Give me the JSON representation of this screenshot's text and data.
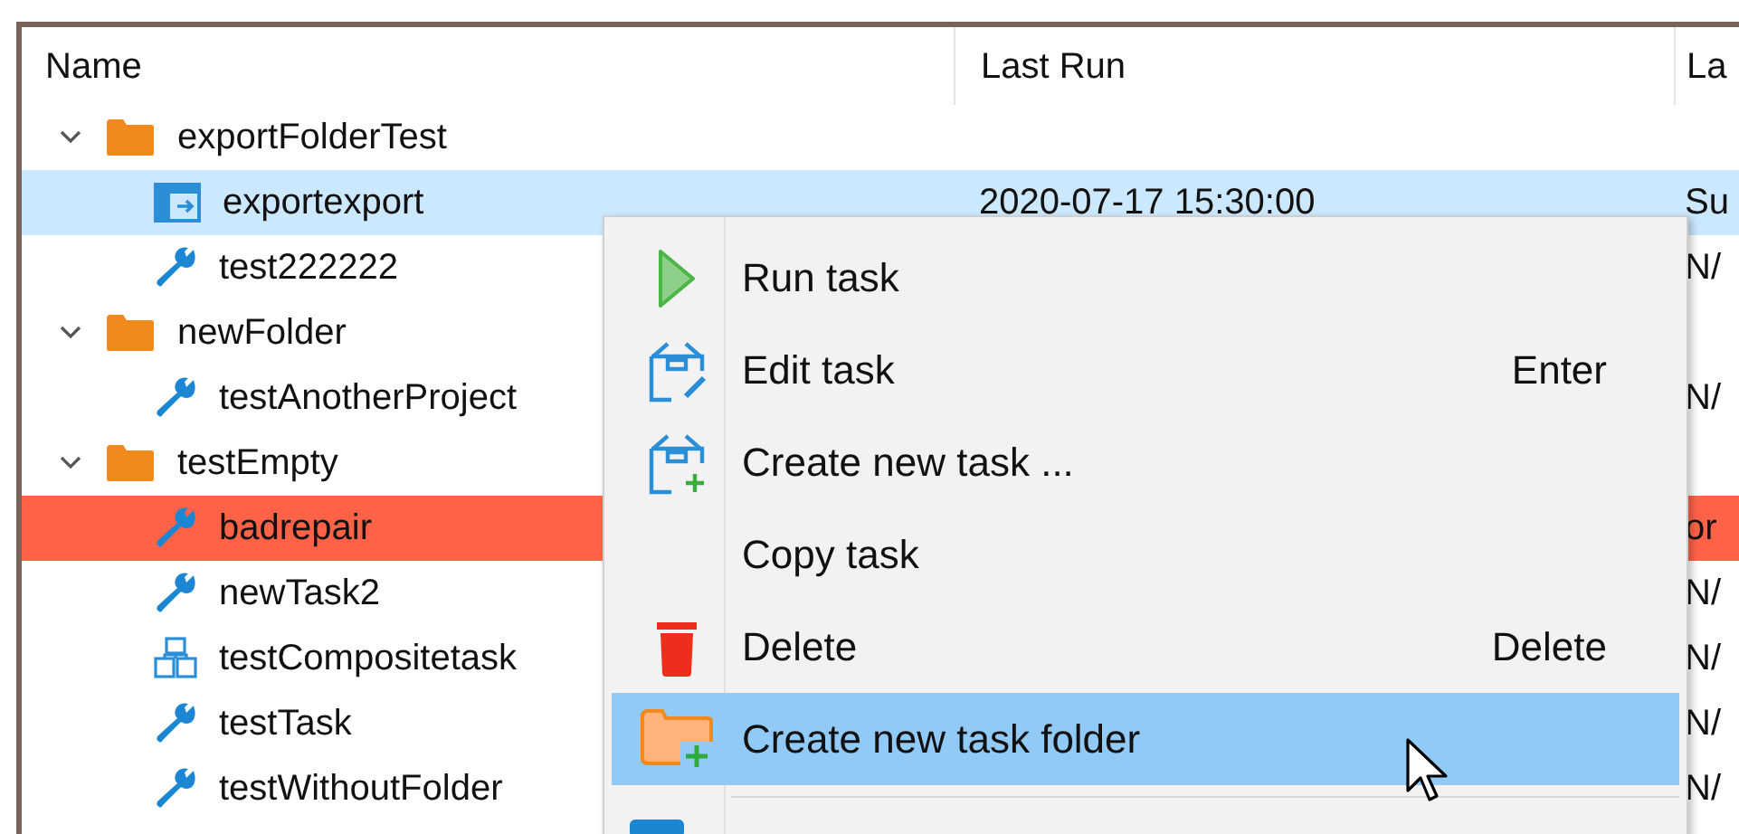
{
  "table": {
    "columns": [
      "Name",
      "Last Run",
      "La"
    ],
    "rows": [
      {
        "name": "exportFolderTest",
        "kind": "folder",
        "expanded": true,
        "children": [
          {
            "name": "exportexport",
            "kind": "export",
            "selected": true,
            "failed": false,
            "last_run": "2020-07-17 15:30:00",
            "column_3": "Su"
          },
          {
            "name": "test222222",
            "kind": "wrench",
            "selected": false,
            "failed": false,
            "column_3": "N/"
          }
        ]
      },
      {
        "name": "newFolder",
        "kind": "folder",
        "expanded": true,
        "children": [
          {
            "name": "testAnotherProject",
            "kind": "wrench",
            "selected": false,
            "failed": false,
            "column_3": "N/"
          }
        ]
      },
      {
        "name": "testEmpty",
        "kind": "folder",
        "expanded": true,
        "children": [
          {
            "name": "badrepair",
            "kind": "wrench",
            "selected": false,
            "failed": true,
            "column_3": "or"
          },
          {
            "name": "newTask2",
            "kind": "wrench",
            "selected": false,
            "failed": false,
            "column_3": "N/"
          },
          {
            "name": "testCompositetask",
            "kind": "composite",
            "selected": false,
            "failed": false,
            "column_3": "N/"
          },
          {
            "name": "testTask",
            "kind": "wrench",
            "selected": false,
            "failed": false,
            "column_3": "N/"
          },
          {
            "name": "testWithoutFolder",
            "kind": "wrench",
            "selected": false,
            "failed": false,
            "column_3": "N/"
          }
        ]
      }
    ]
  },
  "context_menu": {
    "items": [
      {
        "label": "Run task",
        "kind": "run",
        "selected": false
      },
      {
        "label": "Edit task",
        "shortcut": "Enter",
        "kind": "edit",
        "selected": false
      },
      {
        "label": "Create new task ...",
        "kind": "new",
        "selected": false
      },
      {
        "label": "Copy task",
        "kind": "plain",
        "selected": false
      },
      {
        "label": "Delete",
        "shortcut": "Delete",
        "kind": "delete",
        "selected": false
      },
      {
        "label": "Create new task folder",
        "kind": "folder",
        "selected": true
      }
    ]
  }
}
